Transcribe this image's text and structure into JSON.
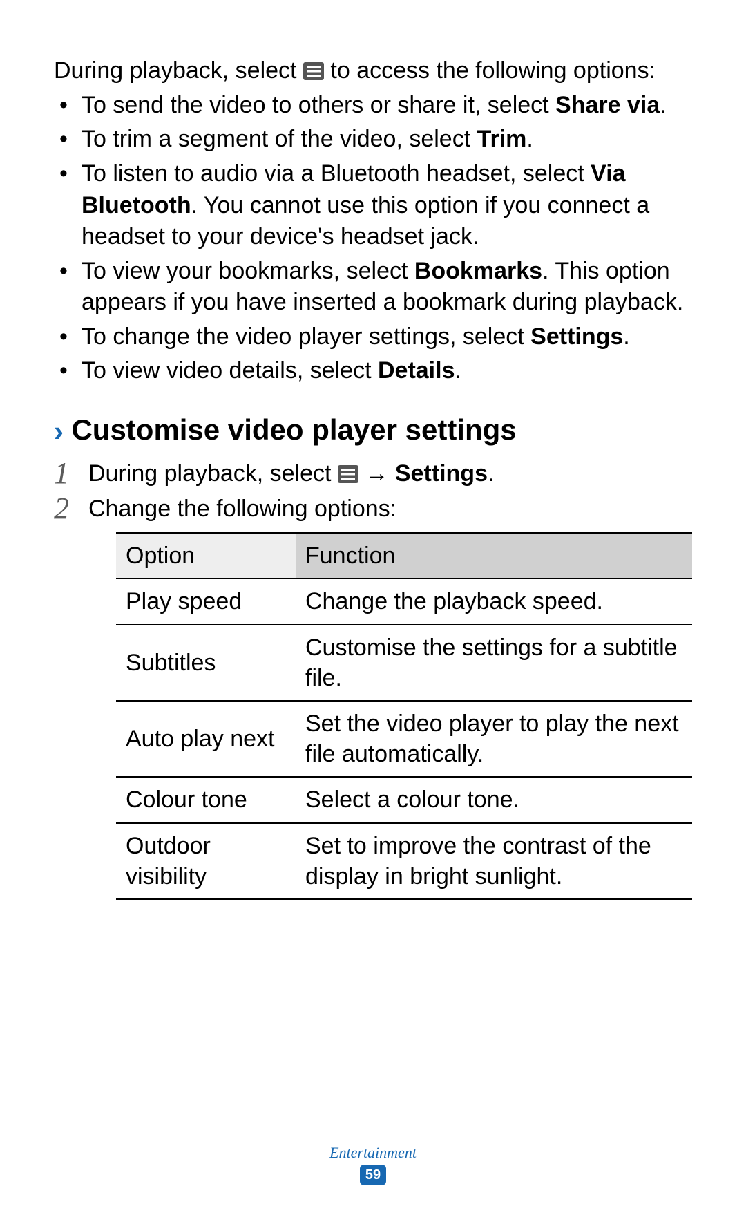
{
  "intro": {
    "prefix": "During playback, select ",
    "suffix": " to access the following options:"
  },
  "icon_name": "menu-icon",
  "bullets": [
    {
      "pre": "To send the video to others or share it, select ",
      "bold": "Share via",
      "post": "."
    },
    {
      "pre": "To trim a segment of the video, select ",
      "bold": "Trim",
      "post": "."
    },
    {
      "pre": "To listen to audio via a Bluetooth headset, select ",
      "bold": "Via Bluetooth",
      "post": ". You cannot use this option if you connect a headset to your device's headset jack."
    },
    {
      "pre": "To view your bookmarks, select ",
      "bold": "Bookmarks",
      "post": ". This option appears if you have inserted a bookmark during playback."
    },
    {
      "pre": "To change the video player settings, select ",
      "bold": "Settings",
      "post": "."
    },
    {
      "pre": "To view video details, select ",
      "bold": "Details",
      "post": "."
    }
  ],
  "section": {
    "caret": "›",
    "title": "Customise video player settings"
  },
  "steps": {
    "one_num": "1",
    "one_pre": "During playback, select ",
    "one_arrow": " → ",
    "one_bold": "Settings",
    "one_post": ".",
    "two_num": "2",
    "two_text": "Change the following options:"
  },
  "table": {
    "head_option": "Option",
    "head_function": "Function",
    "rows": [
      {
        "opt": "Play speed",
        "fn": "Change the playback speed."
      },
      {
        "opt": "Subtitles",
        "fn": "Customise the settings for a subtitle file."
      },
      {
        "opt": "Auto play next",
        "fn": "Set the video player to play the next file automatically."
      },
      {
        "opt": "Colour tone",
        "fn": "Select a colour tone."
      },
      {
        "opt": "Outdoor visibility",
        "fn": "Set to improve the contrast of the display in bright sunlight."
      }
    ]
  },
  "footer": {
    "category": "Entertainment",
    "page": "59"
  }
}
